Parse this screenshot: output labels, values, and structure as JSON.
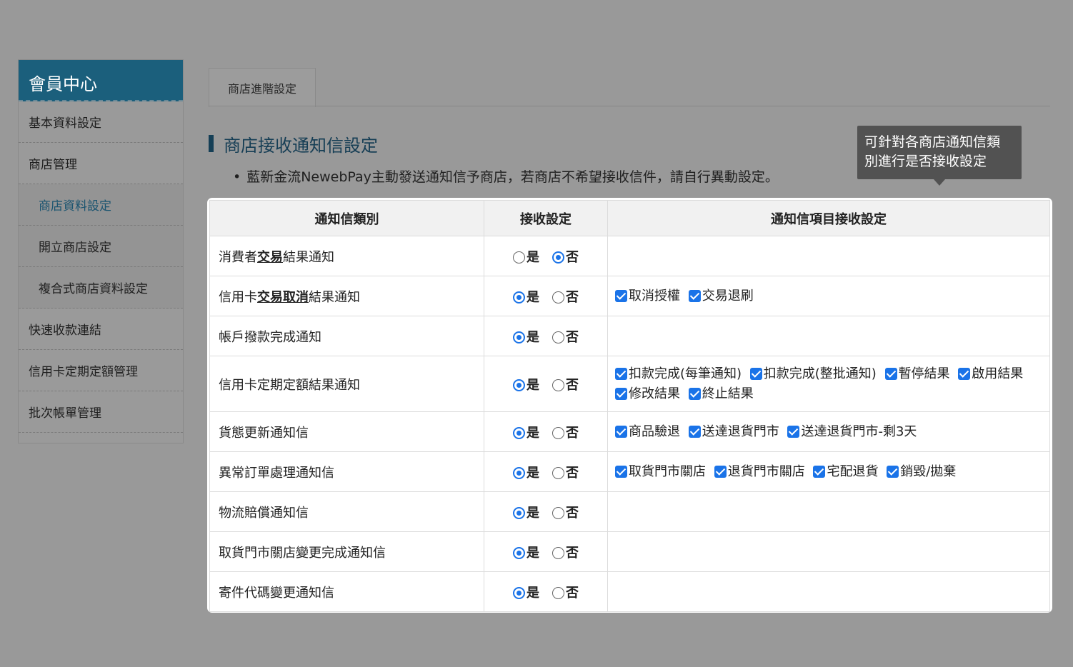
{
  "sidebar": {
    "title": "會員中心",
    "items": [
      {
        "label": "基本資料設定"
      },
      {
        "label": "商店管理"
      },
      {
        "label": "商店資料設定"
      },
      {
        "label": "開立商店設定"
      },
      {
        "label": "複合式商店資料設定"
      },
      {
        "label": "快速收款連結"
      },
      {
        "label": "信用卡定期定額管理"
      },
      {
        "label": "批次帳單管理"
      }
    ]
  },
  "tab": {
    "label": "商店進階設定"
  },
  "section": {
    "title": "商店接收通知信設定",
    "description": "藍新金流NewebPay主動發送通知信予商店，若商店不希望接收信件，請自行異動設定。"
  },
  "tooltip": {
    "line1": "可針對各商店通知信類",
    "line2": "別進行是否接收設定"
  },
  "table": {
    "headers": [
      "通知信類別",
      "接收設定",
      "通知信項目接收設定"
    ],
    "yes_label": "是",
    "no_label": "否",
    "rows": [
      {
        "name_parts": [
          "消費者",
          "交易",
          "結果通知"
        ],
        "receive": "no",
        "items": []
      },
      {
        "name_parts": [
          "信用卡",
          "交易取消",
          "結果通知"
        ],
        "receive": "yes",
        "items": [
          "取消授權",
          "交易退刷"
        ]
      },
      {
        "name": "帳戶撥款完成通知",
        "receive": "yes",
        "items": []
      },
      {
        "name": "信用卡定期定額結果通知",
        "receive": "yes",
        "items": [
          "扣款完成(每筆通知)",
          "扣款完成(整批通知)",
          "暫停結果",
          "啟用結果",
          "修改結果",
          "終止結果"
        ]
      },
      {
        "name": "貨態更新通知信",
        "receive": "yes",
        "items": [
          "商品驗退",
          "送達退貨門市",
          "送達退貨門市-剩3天"
        ]
      },
      {
        "name": "異常訂單處理通知信",
        "receive": "yes",
        "items": [
          "取貨門市關店",
          "退貨門市關店",
          "宅配退貨",
          "銷毀/拋棄"
        ]
      },
      {
        "name": "物流賠償通知信",
        "receive": "yes",
        "items": []
      },
      {
        "name": "取貨門市關店變更完成通知信",
        "receive": "yes",
        "items": []
      },
      {
        "name": "寄件代碼變更通知信",
        "receive": "yes",
        "items": []
      }
    ]
  },
  "colors": {
    "sidebar_header": "#1b5f7c",
    "accent": "#1a73e8",
    "background": "#999999"
  }
}
